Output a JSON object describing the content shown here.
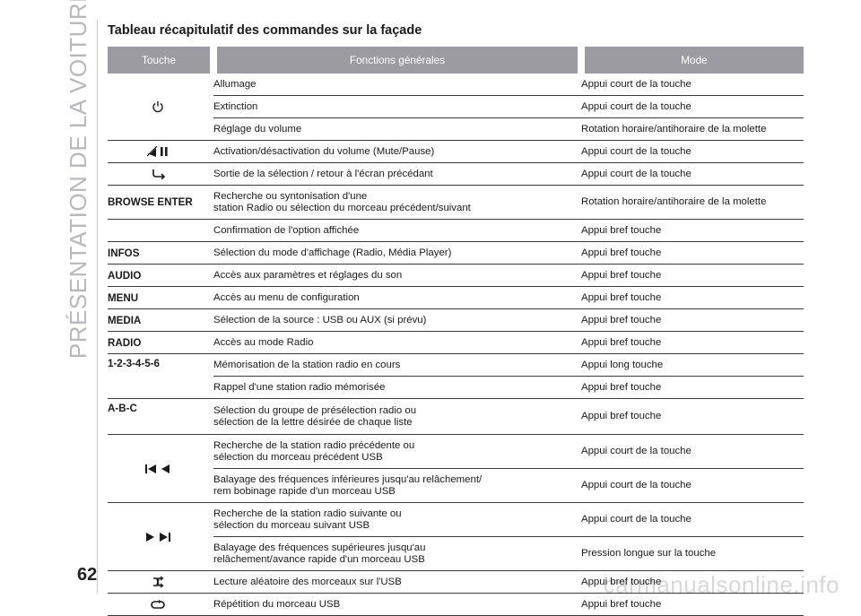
{
  "sidebar": {
    "section_title": "PRÉSENTATION DE LA VOITURE"
  },
  "page": {
    "title": "Tableau récapitulatif des commandes sur la façade",
    "number": "62"
  },
  "table": {
    "headers": [
      "Touche",
      "Fonctions générales",
      "Mode"
    ],
    "rows": [
      {
        "key": "",
        "icon": "power-icon",
        "functions": [
          "Allumage",
          "Extinction",
          "Réglage du volume"
        ],
        "modes": [
          "Appui court de la touche",
          "Appui court de la touche",
          "Rotation horaire/antihoraire de la molette"
        ]
      },
      {
        "key": "",
        "icon": "mute-pause-icon",
        "functions": [
          "Activation/désactivation du volume (Mute/Pause)"
        ],
        "modes": [
          "Appui court de la touche"
        ]
      },
      {
        "key": "",
        "icon": "back-icon",
        "functions": [
          "Sortie de la sélection / retour à l'écran précédant"
        ],
        "modes": [
          "Appui court de la touche"
        ]
      },
      {
        "key": "BROWSE ENTER",
        "functions": [
          "Recherche ou syntonisation d'une\nstation Radio ou sélection du morceau précédent/suivant",
          "Confirmation de l'option affichée"
        ],
        "modes": [
          "Rotation horaire/antihoraire de la molette",
          "Appui bref touche"
        ]
      },
      {
        "key": "INFOS",
        "functions": [
          "Sélection du mode d'affichage (Radio, Média Player)"
        ],
        "modes": [
          "Appui bref touche"
        ]
      },
      {
        "key": "AUDIO",
        "functions": [
          "Accès aux paramètres et réglages du son"
        ],
        "modes": [
          "Appui bref touche"
        ]
      },
      {
        "key": "MENU",
        "functions": [
          "Accès au menu de configuration"
        ],
        "modes": [
          "Appui bref touche"
        ]
      },
      {
        "key": "MEDIA",
        "functions": [
          "Sélection de la source : USB ou AUX (si prévu)"
        ],
        "modes": [
          "Appui bref touche"
        ]
      },
      {
        "key": "RADIO",
        "functions": [
          "Accès au mode Radio"
        ],
        "modes": [
          "Appui bref touche"
        ]
      },
      {
        "key": "1-2-3-4-5-6",
        "functions": [
          "Mémorisation de la station radio en cours",
          "Rappel d'une station radio mémorisée"
        ],
        "modes": [
          "Appui long touche",
          "Appui bref touche"
        ]
      },
      {
        "key": "A-B-C",
        "functions": [
          "Sélection du groupe de présélection radio ou\nsélection de la lettre désirée de chaque liste"
        ],
        "modes": [
          "Appui bref touche"
        ]
      },
      {
        "key": "",
        "icon": "previous-rewind-icon",
        "functions": [
          "Recherche de la station radio précédente ou\nsélection du morceau précédent USB",
          "Balayage des fréquences inférieures jusqu'au relâchement/\nrem bobinage rapide d'un morceau USB"
        ],
        "modes": [
          "Appui court de la touche",
          "Appui court de la touche"
        ]
      },
      {
        "key": "",
        "icon": "forward-next-icon",
        "functions": [
          "Recherche de la station radio suivante ou\nsélection du morceau suivant USB",
          "Balayage des fréquences supérieures jusqu'au\nrelâchement/avance rapide d'un morceau USB"
        ],
        "modes": [
          "Appui court de la touche",
          "Pression longue sur la touche"
        ]
      },
      {
        "key": "",
        "icon": "shuffle-icon",
        "functions": [
          "Lecture aléatoire des morceaux sur l'USB"
        ],
        "modes": [
          "Appui bref touche"
        ]
      },
      {
        "key": "",
        "icon": "repeat-icon",
        "functions": [
          "Répétition du morceau USB"
        ],
        "modes": [
          "Appui bref touche"
        ]
      }
    ]
  },
  "watermark": "carmanualsonline.info"
}
